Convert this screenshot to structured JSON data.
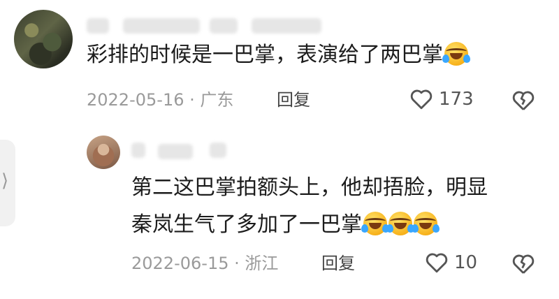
{
  "comments": [
    {
      "text": "彩排的时候是一巴掌，表演给了两巴掌",
      "date": "2022-05-16",
      "location": "广东",
      "reply_label": "回复",
      "likes": "173",
      "emoji_count": 1
    }
  ],
  "reply": {
    "text_line1": "第二这巴掌拍额头上，他却捂脸，明显",
    "text_line2": "秦岚生气了多加了一巴掌",
    "date": "2022-06-15",
    "location": "浙江",
    "reply_label": "回复",
    "likes": "10",
    "emoji_count": 3
  },
  "meta_separator": "·",
  "side_tab_glyph": "⟩",
  "icons": {
    "like": "heart-outline-icon",
    "dislike": "broken-heart-icon",
    "emoji": "laughing-crying-emoji-icon"
  },
  "colors": {
    "text": "#1c1c1c",
    "meta": "#9a9a9a",
    "icon": "#555555",
    "emoji": "#f7b21c"
  }
}
